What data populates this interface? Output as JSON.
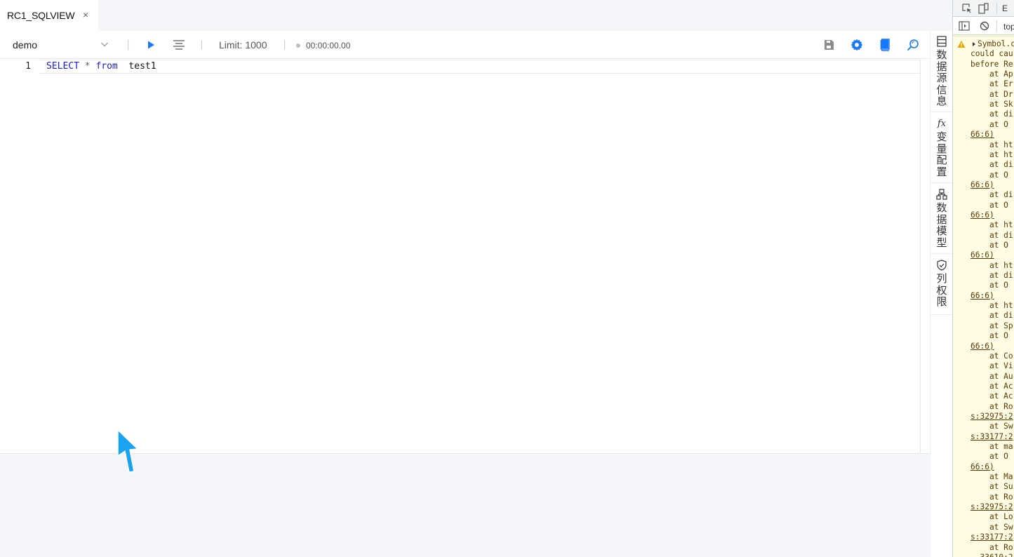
{
  "tab": {
    "title": "RC1_SQLVIEW",
    "close_glyph": "×"
  },
  "toolbar": {
    "database": "demo",
    "limit_label": "Limit: 1000",
    "elapsed": "00:00:00.00"
  },
  "editor": {
    "line_number": "1",
    "tokens": {
      "select": "SELECT",
      "star": "*",
      "from": "from",
      "table": "test1"
    }
  },
  "side_panel": {
    "items": [
      {
        "label": "数据源信息",
        "icon": "datasource-icon"
      },
      {
        "label": "变量配置",
        "icon_text": "fx",
        "icon": "function-icon"
      },
      {
        "label": "数据模型",
        "icon": "data-model-icon"
      },
      {
        "label": "列权限",
        "icon": "shield-icon"
      }
    ]
  },
  "devtools": {
    "context": "top",
    "edge_text": "E",
    "console_lines": [
      "Symbol.c",
      "could cau",
      "before Re",
      "    at Ap",
      "    at Er",
      "    at Dr",
      "    at Sk",
      "    at di",
      "    at O",
      "66:6)",
      "    at ht",
      "    at ht",
      "    at di",
      "    at O",
      "66:6)",
      "    at di",
      "    at O",
      "66:6)",
      "    at ht",
      "    at di",
      "    at O",
      "66:6)",
      "    at ht",
      "    at di",
      "    at O",
      "66:6)",
      "    at ht",
      "    at di",
      "    at Sp",
      "    at O",
      "66:6)",
      "    at Co",
      "    at Vi",
      "    at Au",
      "    at Ac",
      "    at Ac",
      "    at Ro",
      "s:32975:2",
      "    at Sw",
      "s:33177:2",
      "    at ma",
      "    at O",
      "66:6)",
      "    at Ma",
      "    at Su",
      "    at Ro",
      "s:32975:2",
      "    at Lo",
      "    at Sw",
      "s:33177:2",
      "    at Ro",
      "  33610:2"
    ]
  },
  "colors": {
    "accent": "#1677ff",
    "keyword": "#1a1ae6",
    "cursor": "#1aa3f0",
    "console_bg": "#fffbe5",
    "panel_bg": "#f4f6f9"
  }
}
